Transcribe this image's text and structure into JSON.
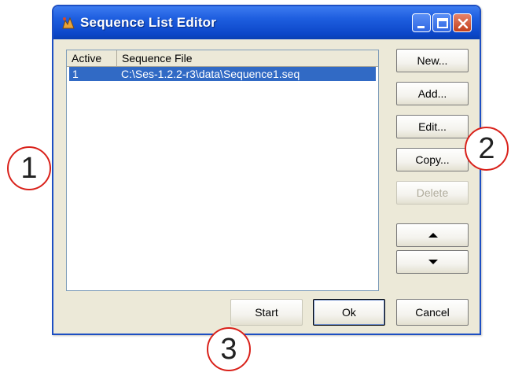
{
  "window": {
    "title": "Sequence List Editor",
    "icon": "app-icon"
  },
  "list": {
    "columns": [
      "Active",
      "Sequence File"
    ],
    "rows": [
      {
        "active": "1",
        "file": "C:\\Ses-1.2.2-r3\\data\\Sequence1.seq",
        "selected": true
      }
    ]
  },
  "buttons": {
    "new": "New...",
    "add": "Add...",
    "edit": "Edit...",
    "copy": "Copy...",
    "delete": "Delete",
    "move_up": "up-arrow-icon",
    "move_down": "down-arrow-icon",
    "start": "Start",
    "ok": "Ok",
    "cancel": "Cancel"
  },
  "callouts": [
    "1",
    "2",
    "3"
  ],
  "colors": {
    "titlebar": "#0b46c8",
    "selection": "#316ac5",
    "callout_ring": "#d9211a"
  }
}
